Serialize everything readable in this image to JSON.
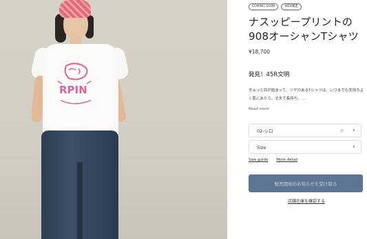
{
  "badges": [
    "COMING SOON",
    "WEB限定"
  ],
  "product": {
    "title": "ナスッピープリントの908オーシャンTシャツ",
    "price": "¥18,700",
    "subhead": "発見！45R文明",
    "description": "ぎゅっと目が詰まって、ツヤのあるTシャツは、いつまでも気持ちよく肌にあたり、丈夫で長持ち。…",
    "read_more": "Read more"
  },
  "selects": {
    "color": {
      "value": "02-シロ",
      "clear_icon": "×",
      "chevron": "▾"
    },
    "size": {
      "value": "Size",
      "chevron": "▾"
    }
  },
  "links": {
    "size_guide": "Size guide",
    "more_detail": "More detail"
  },
  "cta": {
    "label": "販売開始のお知らせを受け取る",
    "color": "#5e7693"
  },
  "store_link": "店舗在庫を確認する",
  "print_text": "RPIN"
}
